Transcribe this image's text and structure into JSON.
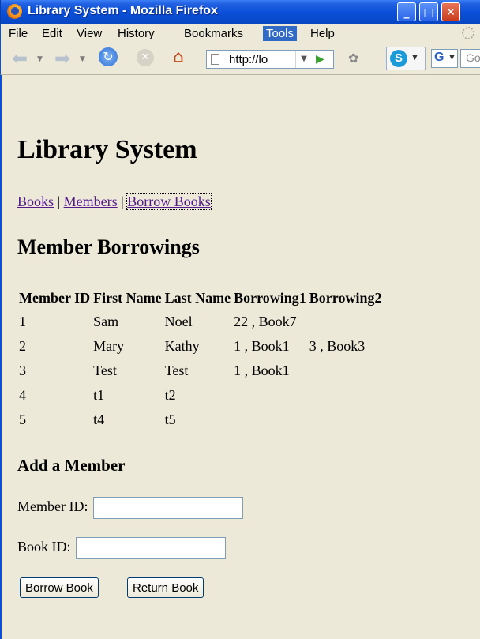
{
  "window": {
    "title": "Library System - Mozilla Firefox"
  },
  "menu": [
    "File",
    "Edit",
    "View",
    "History",
    "Bookmarks",
    "Tools",
    "Help"
  ],
  "menu_active": "Tools",
  "nav": {
    "url": "http://lo",
    "search_placeholder": "Go"
  },
  "page": {
    "title": "Library System",
    "links": [
      "Books",
      "Members",
      "Borrow Books"
    ],
    "link_sep": "|",
    "section_title": "Member Borrowings",
    "table": {
      "headers": [
        "Member ID",
        "First Name",
        "Last Name",
        "Borrowing1",
        "Borrowing2"
      ],
      "rows": [
        [
          "1",
          "Sam",
          "Noel",
          "22 , Book7",
          ""
        ],
        [
          "2",
          "Mary",
          "Kathy",
          "1 , Book1",
          "3 , Book3"
        ],
        [
          "3",
          "Test",
          "Test",
          "1 , Book1",
          ""
        ],
        [
          "4",
          "t1",
          "t2",
          "",
          ""
        ],
        [
          "5",
          "t4",
          "t5",
          "",
          ""
        ]
      ]
    },
    "form": {
      "title": "Add a Member",
      "member_label": "Member ID:",
      "member_value": "",
      "book_label": "Book ID:",
      "book_value": "",
      "borrow_button": "Borrow Book",
      "return_button": "Return Book"
    }
  }
}
